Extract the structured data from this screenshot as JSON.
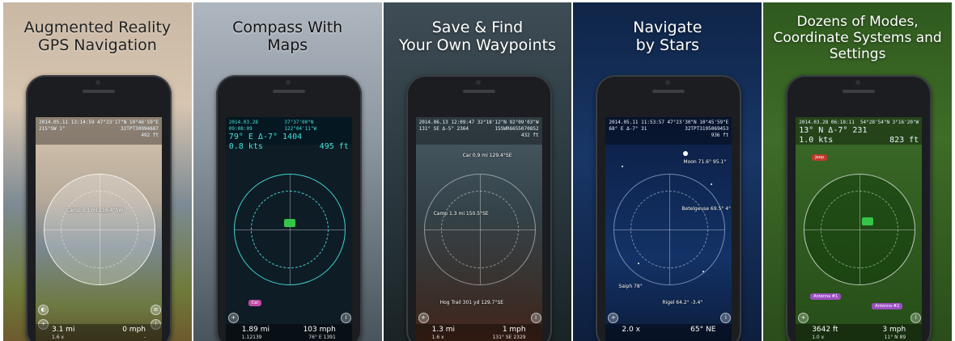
{
  "colors": {
    "accent_cyan": "#3fd4cf",
    "marker_green": "#35c648",
    "tag_pink": "#c04ca6",
    "tag_purple": "#9b4fc2",
    "tag_red": "#c0392b"
  },
  "panels": [
    {
      "headline": [
        "Augmented Reality",
        "GPS Navigation"
      ],
      "hud": {
        "date": "2014.05.11 13:14:59",
        "coords": "47°23'17\"N 10°46'59\"E",
        "sub_left": "215°SW 1°",
        "sub_right": "32TPT30994687",
        "sub_right2": "492 ft"
      },
      "waypoint": "Camp 3.1 mi 216.4°SW",
      "footer": {
        "left": "3.1 mi",
        "right": "0 mph",
        "left_sub": "1.6 x",
        "right_sub": "-"
      },
      "icon": "augmented-reality-icon"
    },
    {
      "headline": [
        "Compass With",
        "Maps"
      ],
      "hud": {
        "date": "2014.03.28 09:08:09",
        "coords": "37°37'00\"N 122°04'11\"W",
        "sub_left": "79° E Δ-7° 1404",
        "sub_right": "",
        "sub_right2": "",
        "speed": "0.8 kts",
        "altitude": "495 ft"
      },
      "waypoint": "Car",
      "footer": {
        "left": "1.89 mi",
        "right": "103 mph",
        "left_sub": "1.12139",
        "right_sub": "76° E 1391"
      },
      "icon": "map-icon"
    },
    {
      "headline": [
        "Save & Find",
        "Your Own Waypoints"
      ],
      "hud": {
        "date": "2014.06.13 12:09:47",
        "coords": "32°18'12\"N 92°09'03\"W",
        "sub_left": "131° SE Δ-5° 2364",
        "sub_right": "15SWR6655070852",
        "sub_right2": "432 ft"
      },
      "waypoints": [
        "Car 0.9 mi 129.4°SE",
        "Camp 1.3 mi 150.5°SE",
        "Hog Trail 301 yd 129.7°SE"
      ],
      "footer": {
        "left": "1.3 mi",
        "right": "1 mph",
        "left_sub": "1.6 x",
        "right_sub": "131° SE 2329"
      },
      "icon": "waypoint-icon"
    },
    {
      "headline": [
        "Navigate",
        "by Stars"
      ],
      "hud": {
        "date": "2014.05.11 11:53:57",
        "coords": "47°23'30\"N 10°45'59\"E",
        "sub_left": "68° E Δ-7° 31",
        "sub_right": "32TPT3195069453",
        "sub_right2": "936 ft"
      },
      "stars_labels": [
        "Moon 71.6° 95.1°",
        "Betelgeuse 69.5° 4°",
        "Saiph 78°",
        "Rigel 64.2° -3.4°"
      ],
      "footer": {
        "left": "2.0 x",
        "right": "65° NE",
        "left_sub": "",
        "right_sub": ""
      },
      "icon": "star-icon"
    },
    {
      "headline": [
        "Dozens of Modes,",
        "Coordinate Systems and",
        "Settings"
      ],
      "hud": {
        "date": "2014.03.28 06:18:11",
        "coords": "54°28'54\"N 3°16'20\"W",
        "sub_left": "13° N Δ-7° 231",
        "sub_right": "",
        "sub_right2": "",
        "speed": "1.0 kts",
        "altitude": "823 ft"
      },
      "tags": [
        "Jeep",
        "Antenna #1",
        "Antenna #2"
      ],
      "footer": {
        "left": "3642 ft",
        "right": "3 mph",
        "left_sub": "1.0 x",
        "right_sub": "11° N 89"
      },
      "icon": "settings-icon"
    }
  ]
}
